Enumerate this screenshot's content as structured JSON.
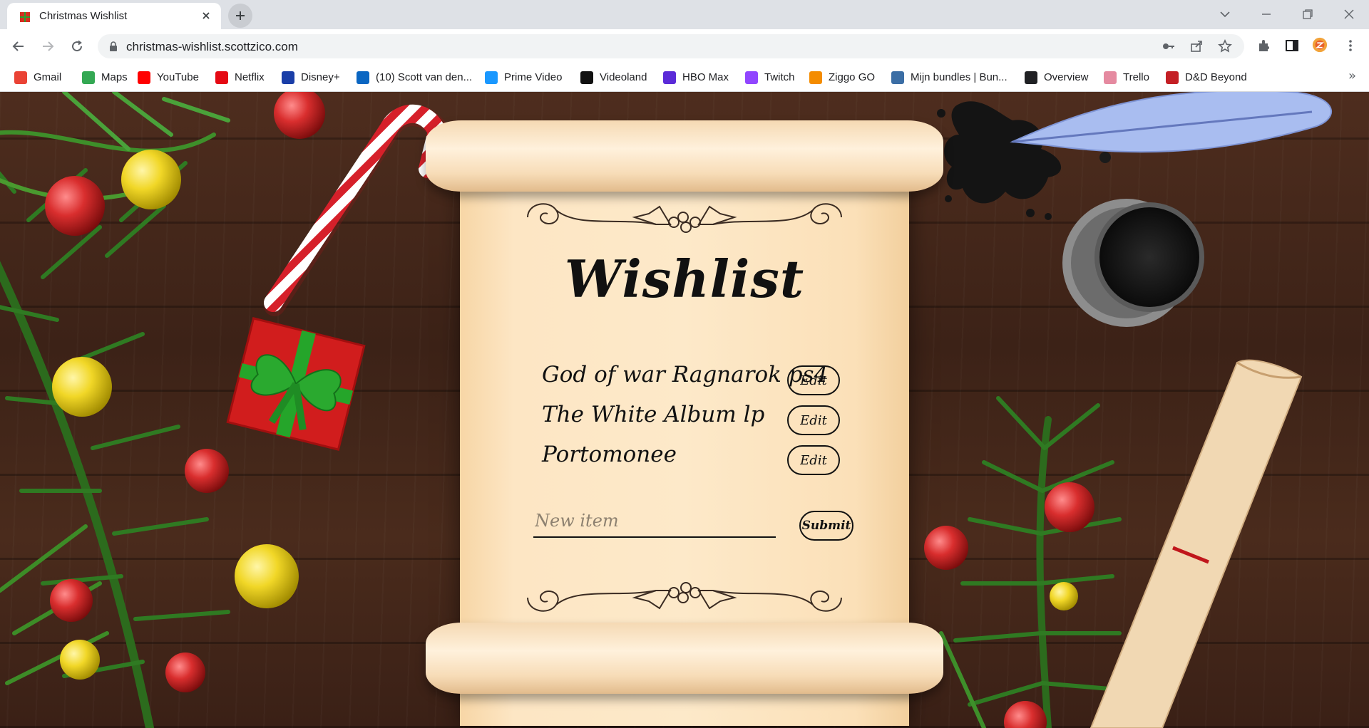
{
  "browser": {
    "tab_title": "Christmas Wishlist",
    "url": "christmas-wishlist.scottzico.com",
    "bookmarks": [
      {
        "label": "Gmail",
        "icon": "gmail-icon",
        "color": "#ea4335"
      },
      {
        "label": "Maps",
        "icon": "maps-icon",
        "color": "#34a853"
      },
      {
        "label": "YouTube",
        "icon": "youtube-icon",
        "color": "#ff0000"
      },
      {
        "label": "Netflix",
        "icon": "netflix-icon",
        "color": "#e50914"
      },
      {
        "label": "Disney+",
        "icon": "disney-icon",
        "color": "#1a3ea8"
      },
      {
        "label": "(10) Scott van den...",
        "icon": "linkedin-icon",
        "color": "#0a66c2"
      },
      {
        "label": "Prime Video",
        "icon": "prime-video-icon",
        "color": "#1a98ff"
      },
      {
        "label": "Videoland",
        "icon": "videoland-icon",
        "color": "#111111"
      },
      {
        "label": "HBO Max",
        "icon": "hbo-max-icon",
        "color": "#5b2bd8"
      },
      {
        "label": "Twitch",
        "icon": "twitch-icon",
        "color": "#9146ff"
      },
      {
        "label": "Ziggo GO",
        "icon": "ziggo-icon",
        "color": "#f48c00"
      },
      {
        "label": "Mijn bundles | Bun...",
        "icon": "humble-bundle-icon",
        "color": "#3b6ea5"
      },
      {
        "label": "Overview",
        "icon": "github-icon",
        "color": "#202124"
      },
      {
        "label": "Trello",
        "icon": "trello-icon",
        "color": "#e58aa0"
      },
      {
        "label": "D&D Beyond",
        "icon": "dnd-beyond-icon",
        "color": "#c41f25"
      }
    ]
  },
  "wishlist": {
    "title": "Wishlist",
    "items": [
      {
        "name": "God of war Ragnarok ps4",
        "edit_label": "Edit"
      },
      {
        "name": "The White Album lp",
        "edit_label": "Edit"
      },
      {
        "name": "Portomonee",
        "edit_label": "Edit"
      }
    ],
    "new_item_placeholder": "New item",
    "submit_label": "Submit"
  }
}
